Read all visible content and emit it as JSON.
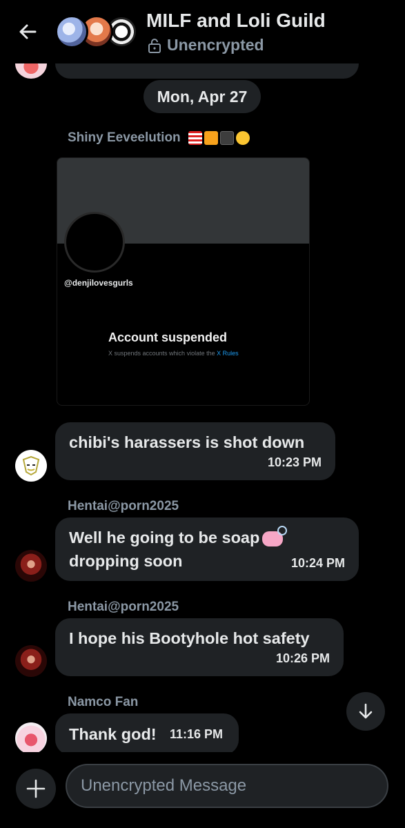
{
  "header": {
    "title": "MILF and Loli Guild",
    "subtitle": "Unencrypted"
  },
  "date_separator": "Mon, Apr 27",
  "messages": [
    {
      "sender": "Shiny Eeveelution",
      "sender_badges": [
        "us-flag",
        "orange-square",
        "black-square",
        "crying-face"
      ],
      "type": "media",
      "media": {
        "handle": "@denjilovesgurls",
        "title": "Account suspended",
        "note_prefix": "X suspends accounts which violate the",
        "note_link": "X Rules"
      }
    },
    {
      "text": "chibi's harassers is shot down",
      "time": "10:23 PM"
    },
    {
      "sender": "Hentai@porn2025",
      "text_line1": "Well he going to be soap",
      "text_line2": "dropping soon",
      "time": "10:24 PM"
    },
    {
      "sender": "Hentai@porn2025",
      "text": "I hope his Bootyhole hot safety",
      "time": "10:26 PM"
    },
    {
      "sender": "Namco Fan",
      "text": "Thank god!",
      "time": "11:16 PM"
    }
  ],
  "composer": {
    "placeholder": "Unencrypted Message"
  },
  "icons": {
    "back": "arrow-left-icon",
    "lock": "lock-open-icon",
    "scroll_down": "arrow-down-icon",
    "add": "plus-icon"
  },
  "colors": {
    "background": "#000000",
    "bubble": "#1f2225",
    "muted_text": "#8b98a5",
    "link": "#1d9bf0"
  }
}
